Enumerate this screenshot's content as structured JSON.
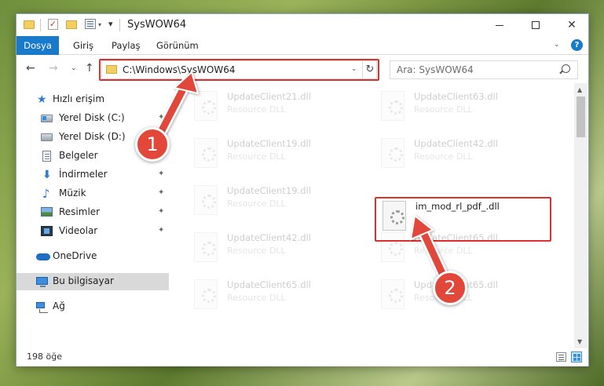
{
  "window": {
    "title": "SysWOW64",
    "controls": {
      "minimize": "",
      "maximize": "",
      "close": "✕"
    }
  },
  "quick_access_toolbar": {
    "dropdown_glyph": "▾",
    "pin_glyph": "✓"
  },
  "ribbon": {
    "tabs": [
      {
        "label": "Dosya"
      },
      {
        "label": "Giriş"
      },
      {
        "label": "Paylaş"
      },
      {
        "label": "Görünüm"
      }
    ],
    "collapse_glyph": "⌄",
    "help_label": "?"
  },
  "navigation": {
    "back_glyph": "←",
    "forward_glyph": "→",
    "recent_glyph": "⌄",
    "up_glyph": "↑",
    "address": "C:\\Windows\\SysWOW64",
    "address_dropdown_glyph": "⌄",
    "refresh_glyph": "↻",
    "search_placeholder": "Ara: SysWOW64"
  },
  "sidebar": {
    "items": [
      {
        "label": "Hızlı erişim",
        "icon": "star-icon",
        "pinned": false
      },
      {
        "label": "Yerel Disk (C:)",
        "icon": "windows-drive-icon",
        "pinned": true
      },
      {
        "label": "Yerel Disk (D:)",
        "icon": "drive-icon",
        "pinned": true
      },
      {
        "label": "Belgeler",
        "icon": "documents-icon",
        "pinned": true
      },
      {
        "label": "İndirmeler",
        "icon": "download-icon",
        "pinned": true
      },
      {
        "label": "Müzik",
        "icon": "music-icon",
        "pinned": true
      },
      {
        "label": "Resimler",
        "icon": "pictures-icon",
        "pinned": true
      },
      {
        "label": "Videolar",
        "icon": "videos-icon",
        "pinned": true
      },
      {
        "label": "OneDrive",
        "icon": "cloud-icon",
        "pinned": false
      },
      {
        "label": "Bu bilgisayar",
        "icon": "computer-icon",
        "pinned": false,
        "selected": true
      },
      {
        "label": "Ağ",
        "icon": "network-icon",
        "pinned": false
      }
    ],
    "pin_glyph": "📌"
  },
  "files": [
    {
      "name": "UpdateClient21.dll",
      "type": "Resource DLL",
      "faded": true
    },
    {
      "name": "UpdateClient63.dll",
      "type": "Resource DLL",
      "faded": true
    },
    {
      "name": "UpdateClient19.dll",
      "type": "Resource DLL",
      "faded": true
    },
    {
      "name": "UpdateClient42.dll",
      "type": "Resource DLL",
      "faded": true
    },
    {
      "name": "UpdateClient19.dll",
      "type": "Resource DLL",
      "faded": true
    },
    {
      "name": "im_mod_rl_pdf_.dll",
      "type": "",
      "faded": false,
      "highlighted": true
    },
    {
      "name": "UpdateClient42.dll",
      "type": "Resource DLL",
      "faded": true
    },
    {
      "name": "UpdateClient65.dll",
      "type": "Resource DLL",
      "faded": true
    },
    {
      "name": "UpdateClient65.dll",
      "type": "Resource DLL",
      "faded": true
    },
    {
      "name": "UpdateClient65.dll",
      "type": "Resource DLL",
      "faded": true
    }
  ],
  "scrollbar": {
    "up_glyph": "▲",
    "down_glyph": "▼",
    "position": 0.0
  },
  "status": {
    "item_count": "198 öğe"
  },
  "annotations": {
    "marker_1": "1",
    "marker_2": "2",
    "highlight_color": "#d9312b",
    "marker_color": "#e2473a"
  },
  "colors": {
    "accent": "#1979ca",
    "selection": "#d9d9d9"
  }
}
